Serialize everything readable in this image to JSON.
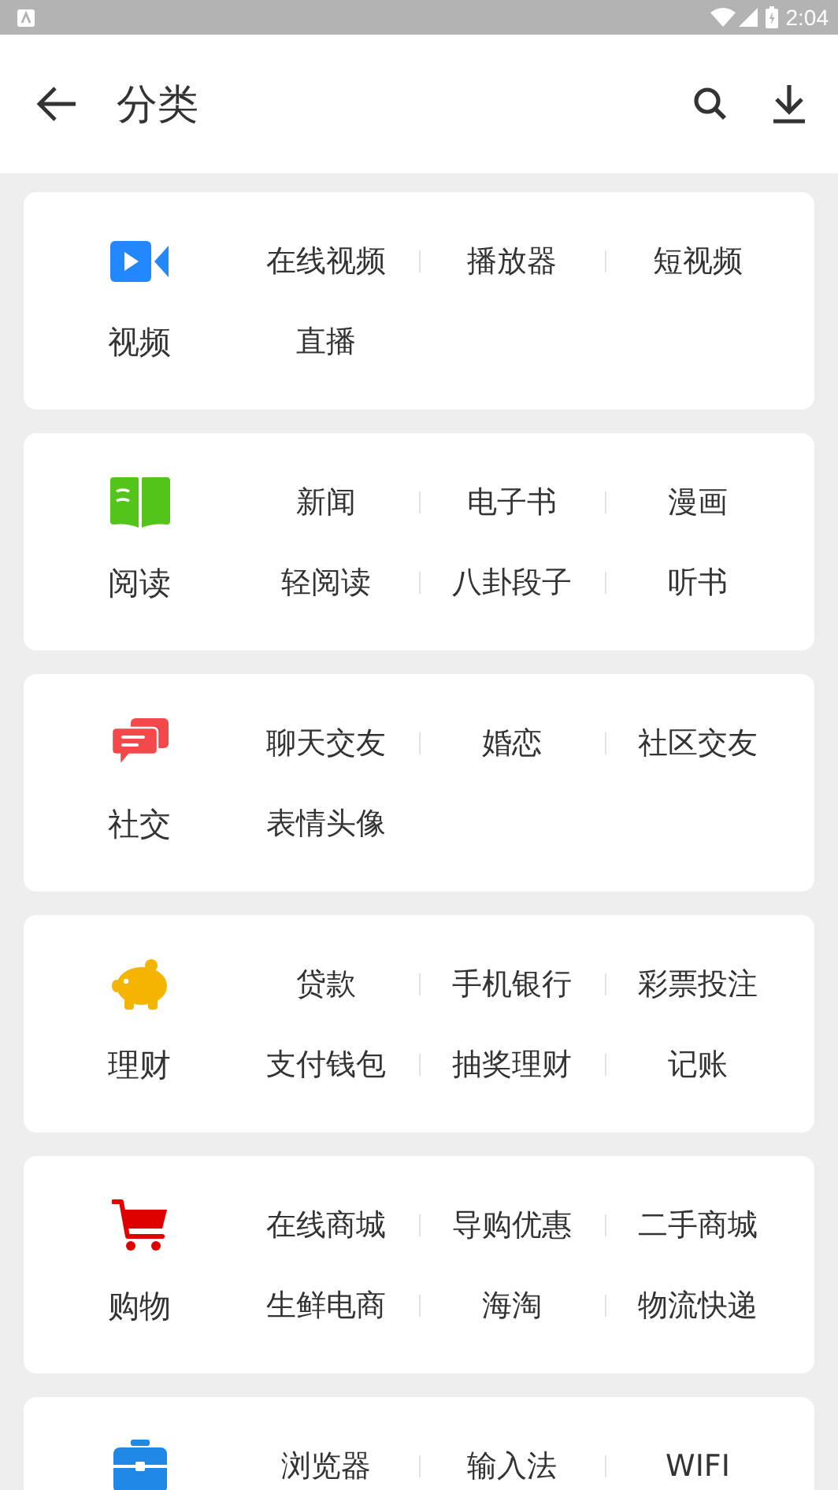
{
  "status_bar": {
    "time": "2:04"
  },
  "app_bar": {
    "title": "分类"
  },
  "categories": [
    {
      "name": "视频",
      "kind": "video",
      "color": "#2188ff",
      "items": [
        "在线视频",
        "播放器",
        "短视频",
        "直播"
      ]
    },
    {
      "name": "阅读",
      "kind": "book",
      "color": "#52c41a",
      "items": [
        "新闻",
        "电子书",
        "漫画",
        "轻阅读",
        "八卦段子",
        "听书"
      ]
    },
    {
      "name": "社交",
      "kind": "chat",
      "color": "#f5484a",
      "items": [
        "聊天交友",
        "婚恋",
        "社区交友",
        "表情头像"
      ]
    },
    {
      "name": "理财",
      "kind": "piggy",
      "color": "#f4b400",
      "items": [
        "贷款",
        "手机银行",
        "彩票投注",
        "支付钱包",
        "抽奖理财",
        "记账"
      ]
    },
    {
      "name": "购物",
      "kind": "cart",
      "color": "#e00000",
      "items": [
        "在线商城",
        "导购优惠",
        "二手商城",
        "生鲜电商",
        "海淘",
        "物流快递"
      ]
    },
    {
      "kind": "briefcase",
      "color": "#1e88e5",
      "items": [
        "浏览器",
        "输入法",
        "WIFI"
      ]
    }
  ]
}
